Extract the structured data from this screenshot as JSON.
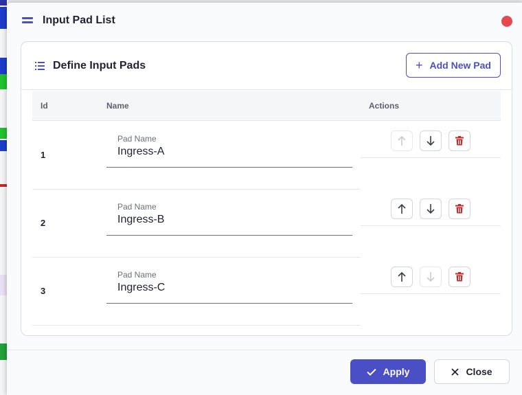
{
  "dialog": {
    "title": "Input Pad List"
  },
  "card": {
    "title": "Define Input Pads",
    "add_button_label": "Add New Pad"
  },
  "table": {
    "columns": {
      "id": "Id",
      "name": "Name",
      "actions": "Actions"
    },
    "rows": [
      {
        "id": "1",
        "field_label": "Pad Name",
        "value": "Ingress-A",
        "up_enabled": false,
        "down_enabled": true
      },
      {
        "id": "2",
        "field_label": "Pad Name",
        "value": "Ingress-B",
        "up_enabled": true,
        "down_enabled": true
      },
      {
        "id": "3",
        "field_label": "Pad Name",
        "value": "Ingress-C",
        "up_enabled": true,
        "down_enabled": false
      }
    ]
  },
  "footer": {
    "apply_label": "Apply",
    "close_label": "Close"
  },
  "colors": {
    "accent": "#4b4fc5",
    "danger": "#c62828",
    "close_dot": "#e5484d"
  },
  "icons": {
    "header": "hamburger-icon",
    "card": "list-icon",
    "add": "plus-icon",
    "move_up": "arrow-up-icon",
    "move_down": "arrow-down-icon",
    "delete": "trash-icon",
    "apply": "check-icon",
    "close": "x-icon"
  }
}
